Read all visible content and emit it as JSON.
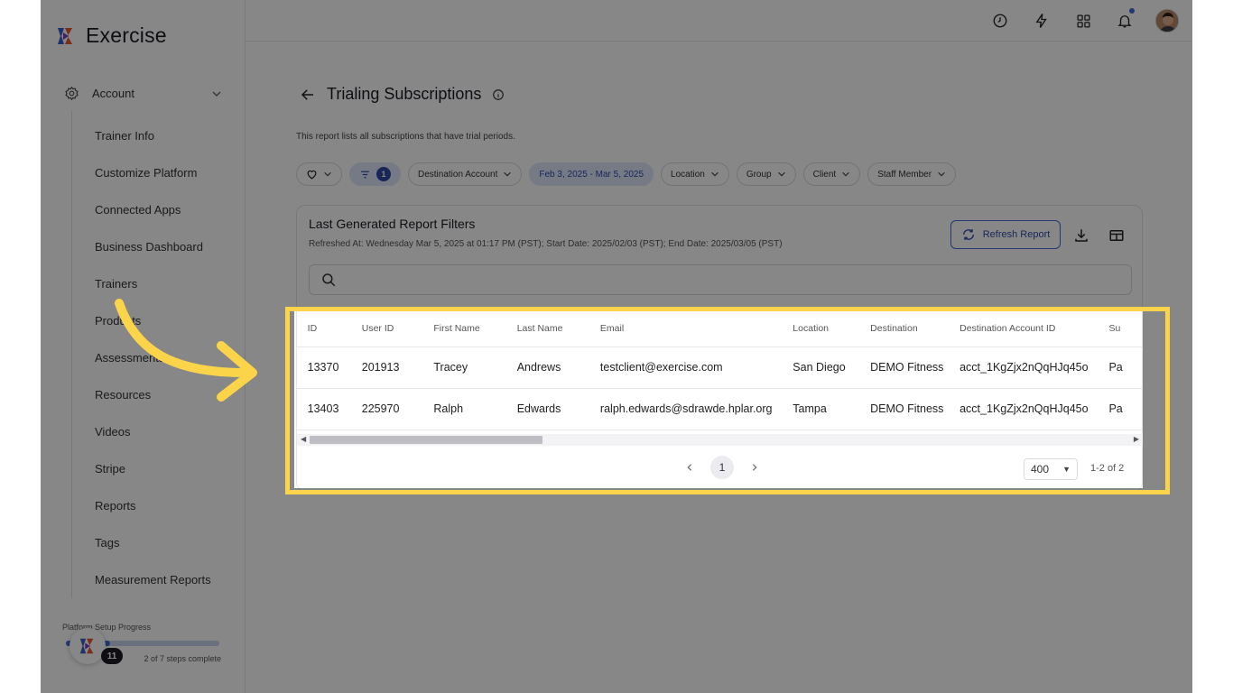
{
  "app": {
    "name": "Exercise"
  },
  "sidebar": {
    "account_label": "Account",
    "items": [
      {
        "label": "Trainer Info"
      },
      {
        "label": "Customize Platform"
      },
      {
        "label": "Connected Apps"
      },
      {
        "label": "Business Dashboard"
      },
      {
        "label": "Trainers"
      },
      {
        "label": "Products"
      },
      {
        "label": "Assessments"
      },
      {
        "label": "Resources"
      },
      {
        "label": "Videos"
      },
      {
        "label": "Stripe"
      },
      {
        "label": "Reports"
      },
      {
        "label": "Tags"
      },
      {
        "label": "Measurement Reports"
      }
    ],
    "progress": {
      "title": "Platform Setup Progress",
      "status": "2 of 7 steps complete",
      "fraction": 0.29,
      "notification_count": "11"
    }
  },
  "topbar": {
    "icons": [
      "clock-icon",
      "lightning-icon",
      "grid-icon",
      "bell-icon"
    ]
  },
  "page": {
    "title": "Trialing Subscriptions",
    "description": "This report lists all subscriptions that have trial periods.",
    "filters": {
      "filter_count": "1",
      "destination_account": "Destination Account",
      "date_range": "Feb 3, 2025 - Mar 5, 2025",
      "location": "Location",
      "group": "Group",
      "client": "Client",
      "staff_member": "Staff Member"
    },
    "report_card": {
      "title": "Last Generated Report Filters",
      "subtitle": "Refreshed At: Wednesday Mar 5, 2025 at 01:17 PM (PST); Start Date: 2025/02/03 (PST); End Date: 2025/03/05 (PST)",
      "refresh_label": "Refresh Report"
    },
    "table": {
      "headers": [
        "ID",
        "User ID",
        "First Name",
        "Last Name",
        "Email",
        "Location",
        "Destination",
        "Destination Account ID",
        "Su"
      ],
      "rows": [
        [
          "13370",
          "201913",
          "Tracey",
          "Andrews",
          "testclient@exercise.com",
          "San Diego",
          "DEMO Fitness",
          "acct_1KgZjx2nQqHJq45o",
          "Pa"
        ],
        [
          "13403",
          "225970",
          "Ralph",
          "Edwards",
          "ralph.edwards@sdrawde.hplar.org",
          "Tampa",
          "DEMO Fitness",
          "acct_1KgZjx2nQqHJq45o",
          "Pa"
        ]
      ]
    },
    "pagination": {
      "current_page": "1",
      "page_size": "400",
      "range": "1-2 of 2"
    }
  },
  "colors": {
    "accent": "#3f6bd8",
    "highlight": "#fbd44a",
    "chip_blue": "#dfe7fb"
  }
}
